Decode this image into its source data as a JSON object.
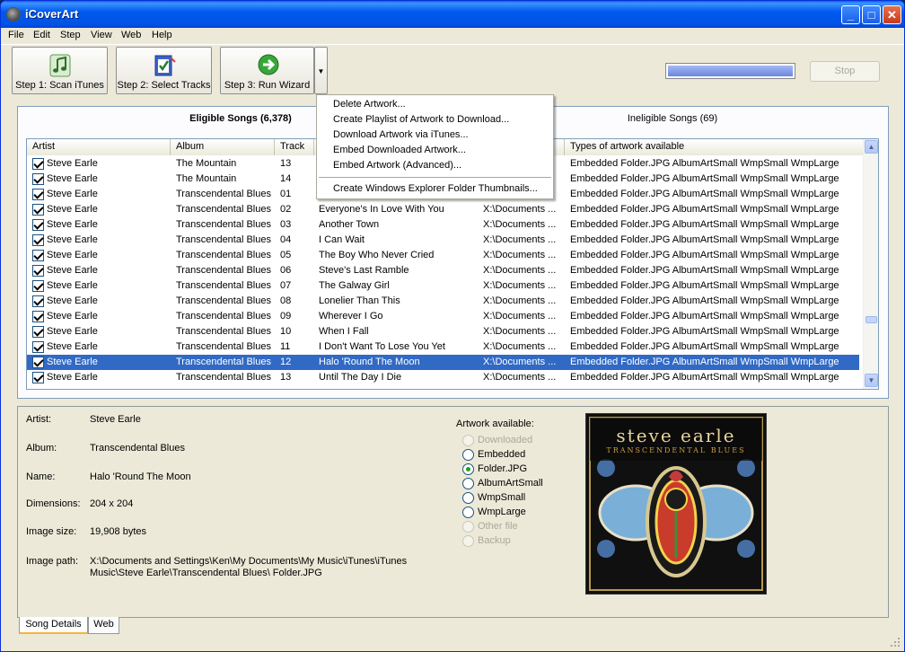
{
  "titlebar": {
    "title": "iCoverArt",
    "minimize": "_",
    "maximize": "□",
    "close": "✕"
  },
  "menu": [
    "File",
    "Edit",
    "Step",
    "View",
    "Web",
    "Help"
  ],
  "toolbar": {
    "buttons": [
      {
        "label": "Step 1: Scan iTunes",
        "icon": "music-note-icon"
      },
      {
        "label": "Step 2: Select Tracks",
        "icon": "checklist-icon"
      },
      {
        "label": "Step 3: Run Wizard",
        "icon": "green-arrow-icon"
      }
    ],
    "dropdown_arrow": "▼",
    "stop_label": "Stop",
    "progress_fraction": 1.0
  },
  "tabs": {
    "eligible": "Eligible Songs (6,378)",
    "ineligible": "Ineligible Songs (69)"
  },
  "columns": [
    "Artist",
    "Album",
    "Track",
    "",
    "",
    "Types of artwork available"
  ],
  "rows": [
    {
      "artist": "Steve Earle",
      "album": "The Mountain",
      "track": "13",
      "name": "",
      "path": "",
      "types": "Embedded Folder.JPG AlbumArtSmall WmpSmall WmpLarge"
    },
    {
      "artist": "Steve Earle",
      "album": "The Mountain",
      "track": "14",
      "name": "",
      "path": "",
      "types": "Embedded Folder.JPG AlbumArtSmall WmpSmall WmpLarge"
    },
    {
      "artist": "Steve Earle",
      "album": "Transcendental Blues",
      "track": "01",
      "name": "",
      "path": "",
      "types": "Embedded Folder.JPG AlbumArtSmall WmpSmall WmpLarge"
    },
    {
      "artist": "Steve Earle",
      "album": "Transcendental Blues",
      "track": "02",
      "name": "Everyone's In Love With You",
      "path": "X:\\Documents ...",
      "types": "Embedded Folder.JPG AlbumArtSmall WmpSmall WmpLarge"
    },
    {
      "artist": "Steve Earle",
      "album": "Transcendental Blues",
      "track": "03",
      "name": "Another Town",
      "path": "X:\\Documents ...",
      "types": "Embedded Folder.JPG AlbumArtSmall WmpSmall WmpLarge"
    },
    {
      "artist": "Steve Earle",
      "album": "Transcendental Blues",
      "track": "04",
      "name": "I Can Wait",
      "path": "X:\\Documents ...",
      "types": "Embedded Folder.JPG AlbumArtSmall WmpSmall WmpLarge"
    },
    {
      "artist": "Steve Earle",
      "album": "Transcendental Blues",
      "track": "05",
      "name": "The Boy Who Never Cried",
      "path": "X:\\Documents ...",
      "types": "Embedded Folder.JPG AlbumArtSmall WmpSmall WmpLarge"
    },
    {
      "artist": "Steve Earle",
      "album": "Transcendental Blues",
      "track": "06",
      "name": "Steve's Last Ramble",
      "path": "X:\\Documents ...",
      "types": "Embedded Folder.JPG AlbumArtSmall WmpSmall WmpLarge"
    },
    {
      "artist": "Steve Earle",
      "album": "Transcendental Blues",
      "track": "07",
      "name": "The Galway Girl",
      "path": "X:\\Documents ...",
      "types": "Embedded Folder.JPG AlbumArtSmall WmpSmall WmpLarge"
    },
    {
      "artist": "Steve Earle",
      "album": "Transcendental Blues",
      "track": "08",
      "name": "Lonelier Than This",
      "path": "X:\\Documents ...",
      "types": "Embedded Folder.JPG AlbumArtSmall WmpSmall WmpLarge"
    },
    {
      "artist": "Steve Earle",
      "album": "Transcendental Blues",
      "track": "09",
      "name": "Wherever I Go",
      "path": "X:\\Documents ...",
      "types": "Embedded Folder.JPG AlbumArtSmall WmpSmall WmpLarge"
    },
    {
      "artist": "Steve Earle",
      "album": "Transcendental Blues",
      "track": "10",
      "name": "When I Fall",
      "path": "X:\\Documents ...",
      "types": "Embedded Folder.JPG AlbumArtSmall WmpSmall WmpLarge"
    },
    {
      "artist": "Steve Earle",
      "album": "Transcendental Blues",
      "track": "11",
      "name": "I Don't Want To Lose You Yet",
      "path": "X:\\Documents ...",
      "types": "Embedded Folder.JPG AlbumArtSmall WmpSmall WmpLarge"
    },
    {
      "artist": "Steve Earle",
      "album": "Transcendental Blues",
      "track": "12",
      "name": "Halo 'Round The Moon",
      "path": "X:\\Documents ...",
      "types": "Embedded Folder.JPG AlbumArtSmall WmpSmall WmpLarge",
      "selected": true
    },
    {
      "artist": "Steve Earle",
      "album": "Transcendental Blues",
      "track": "13",
      "name": "Until The Day I Die",
      "path": "X:\\Documents ...",
      "types": "Embedded Folder.JPG AlbumArtSmall WmpSmall WmpLarge"
    }
  ],
  "dropdown_menu": [
    "Delete Artwork...",
    "Create Playlist of Artwork to Download...",
    "Download Artwork via iTunes...",
    "Embed Downloaded Artwork...",
    "Embed Artwork (Advanced)...",
    "Create Windows Explorer Folder Thumbnails..."
  ],
  "details": {
    "artist_label": "Artist:",
    "artist": "Steve Earle",
    "album_label": "Album:",
    "album": "Transcendental Blues",
    "name_label": "Name:",
    "name": "Halo 'Round The Moon",
    "dimensions_label": "Dimensions:",
    "dimensions": "204 x 204",
    "size_label": "Image size:",
    "size": "19,908 bytes",
    "path_label": "Image path:",
    "path_line1": "X:\\Documents and Settings\\Ken\\My Documents\\My Music\\iTunes\\iTunes",
    "path_line2": "Music\\Steve Earle\\Transcendental Blues\\ Folder.JPG"
  },
  "artwork_available": {
    "title": "Artwork available:",
    "options": [
      {
        "label": "Downloaded",
        "enabled": false,
        "checked": false
      },
      {
        "label": "Embedded",
        "enabled": true,
        "checked": false
      },
      {
        "label": "Folder.JPG",
        "enabled": true,
        "checked": true
      },
      {
        "label": "AlbumArtSmall",
        "enabled": true,
        "checked": false
      },
      {
        "label": "WmpSmall",
        "enabled": true,
        "checked": false
      },
      {
        "label": "WmpLarge",
        "enabled": true,
        "checked": false
      },
      {
        "label": "Other file",
        "enabled": false,
        "checked": false
      },
      {
        "label": "Backup",
        "enabled": false,
        "checked": false
      }
    ]
  },
  "cover": {
    "artist": "steve earle",
    "subtitle": "TRANSCENDENTAL BLUES"
  },
  "bottom_tabs": [
    "Song Details",
    "Web"
  ],
  "scroll": {
    "up": "▲",
    "down": "▼"
  }
}
